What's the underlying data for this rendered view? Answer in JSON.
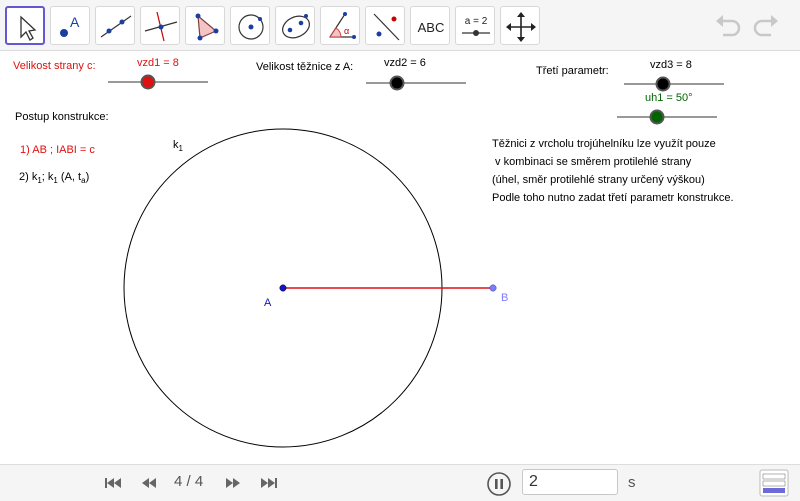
{
  "toolbar": {
    "tools": [
      {
        "name": "move-tool-icon"
      },
      {
        "name": "point-tool-icon"
      },
      {
        "name": "line-tool-icon"
      },
      {
        "name": "perpendicular-tool-icon"
      },
      {
        "name": "polygon-tool-icon"
      },
      {
        "name": "circle-center-tool-icon"
      },
      {
        "name": "conic-tool-icon"
      },
      {
        "name": "angle-tool-icon"
      },
      {
        "name": "reflect-tool-icon"
      },
      {
        "name": "text-tool-icon",
        "label": "ABC"
      },
      {
        "name": "slider-tool-icon",
        "label": "a = 2"
      },
      {
        "name": "move-view-tool-icon"
      }
    ]
  },
  "sliders": {
    "s1": {
      "caption": "Velikost strany c:",
      "label": "vzd1 = 8",
      "value": 8,
      "color": "#e01010"
    },
    "s2": {
      "caption": "Velikost těžnice z A:",
      "label": "vzd2 = 6",
      "value": 6,
      "color": "#000000"
    },
    "s3": {
      "caption": "Třetí parametr:",
      "label": "vzd3 = 8",
      "value": 8,
      "color": "#000000"
    },
    "s4": {
      "label": "uh1 = 50°",
      "value": 50,
      "color": "#006400"
    }
  },
  "construction": {
    "heading": "Postup konstrukce:",
    "step1": "1) AB ; IABI = c",
    "step2_parts": [
      "2) k",
      "1",
      "; k",
      "1",
      " (A, t",
      "a",
      ")"
    ]
  },
  "note_lines": [
    "Těžnici z vrcholu trojúhelníku lze využít pouze",
    " v kombinaci se směrem protilehlé strany",
    "(úhel, směr protilehlé strany určený výškou)",
    "Podle toho nutno zadat třetí parametr konstrukce."
  ],
  "geometry": {
    "circle_label": "k",
    "circle_sub": "1",
    "point_a": "A",
    "point_b": "B"
  },
  "player": {
    "page": "4 / 4",
    "step_value": "2",
    "unit": "s"
  },
  "colors": {
    "accent": "#6557d2",
    "segment": "#e01010",
    "point_a": "#1414c8",
    "point_b": "#7d7dff"
  }
}
